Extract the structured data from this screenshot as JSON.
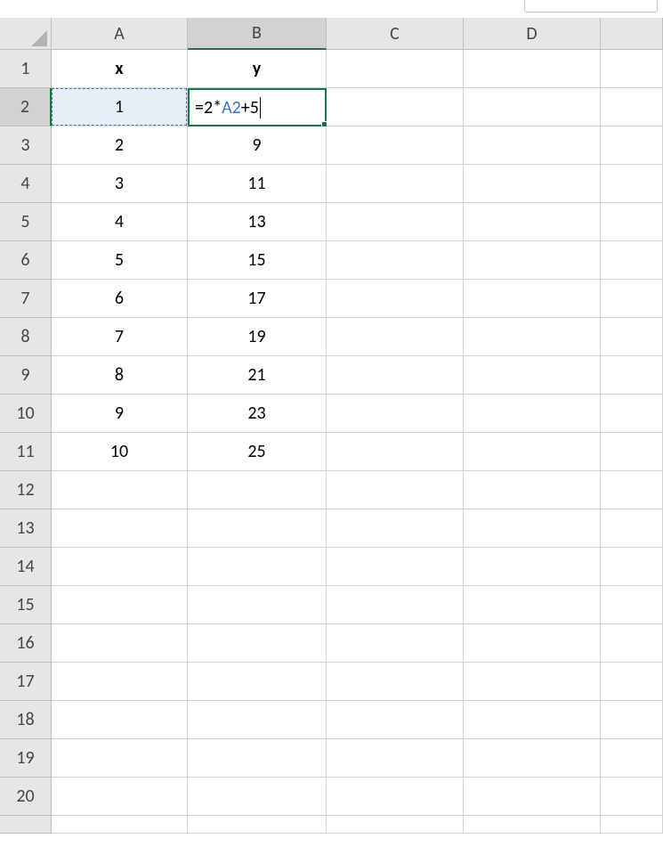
{
  "columns": [
    "A",
    "B",
    "C",
    "D",
    ""
  ],
  "row_numbers": [
    1,
    2,
    3,
    4,
    5,
    6,
    7,
    8,
    9,
    10,
    11,
    12,
    13,
    14,
    15,
    16,
    17,
    18,
    19,
    20
  ],
  "headers": {
    "A": "x",
    "B": "y"
  },
  "data": {
    "A": {
      "2": "1",
      "3": "2",
      "4": "3",
      "5": "4",
      "6": "5",
      "7": "6",
      "8": "7",
      "9": "8",
      "10": "9",
      "11": "10"
    },
    "B": {
      "3": "9",
      "4": "11",
      "5": "13",
      "6": "15",
      "7": "17",
      "8": "19",
      "9": "21",
      "10": "23",
      "11": "25"
    }
  },
  "active_cell": {
    "row": 2,
    "col": "B",
    "formula_prefix": "=2*",
    "formula_ref": "A2",
    "formula_suffix": "+5"
  },
  "referenced_cell": {
    "row": 2,
    "col": "A"
  },
  "selected_col": "B",
  "selected_row": 2,
  "colors": {
    "grid_border": "#d4d4d4",
    "header_bg": "#e6e6e6",
    "selection_green": "#1f7246",
    "reference_blue": "#3a75c4"
  }
}
